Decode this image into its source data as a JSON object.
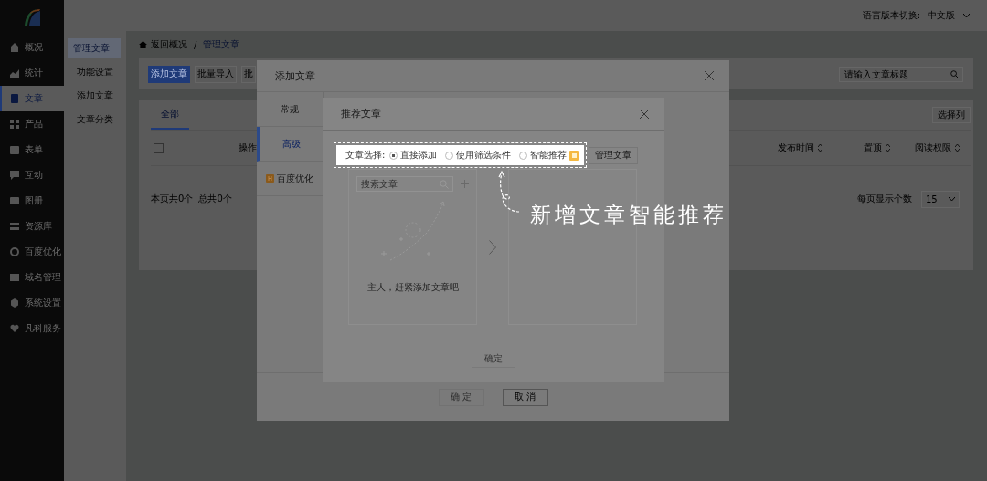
{
  "top_bar": {
    "language_label": "语言版本切换:",
    "language_value": "中文版"
  },
  "sidebar": {
    "items": [
      {
        "label": "概况",
        "selected": false
      },
      {
        "label": "统计",
        "selected": false
      },
      {
        "label": "文章",
        "selected": true
      },
      {
        "label": "产品",
        "selected": false
      },
      {
        "label": "表单",
        "selected": false
      },
      {
        "label": "互动",
        "selected": false
      },
      {
        "label": "图册",
        "selected": false
      },
      {
        "label": "资源库",
        "selected": false
      },
      {
        "label": "百度优化",
        "selected": false
      },
      {
        "label": "域名管理",
        "selected": false
      },
      {
        "label": "系统设置",
        "selected": false
      },
      {
        "label": "凡科服务",
        "selected": false
      }
    ]
  },
  "subnav": {
    "items": [
      {
        "label": "管理文章",
        "selected": true
      },
      {
        "label": "功能设置",
        "selected": false
      },
      {
        "label": "添加文章",
        "selected": false
      },
      {
        "label": "文章分类",
        "selected": false
      }
    ]
  },
  "breadcrumb": {
    "separator": "/",
    "items": [
      "返回概况",
      "管理文章"
    ]
  },
  "toolbar": {
    "buttons": [
      {
        "label": "添加文章",
        "kind": "primary"
      },
      {
        "label": "批量导入",
        "kind": "default"
      },
      {
        "label": "批",
        "kind": "default"
      }
    ],
    "search_placeholder": "请输入文章标题"
  },
  "tabs": [
    {
      "label": "全部",
      "selected": true
    }
  ],
  "column_picker": "选择列",
  "table": {
    "select_all": {
      "checked": false
    },
    "columns": [
      "操作",
      "发布时间",
      "置顶",
      "阅读权限"
    ]
  },
  "pagination": {
    "page_count": "本页共0个",
    "total": "总共0个",
    "per_page_label": "每页显示个数",
    "per_page": "15"
  },
  "add_dialog": {
    "title": "添加文章",
    "tabs": [
      {
        "label": "常规",
        "selected": false,
        "badge": false
      },
      {
        "label": "高级",
        "selected": true,
        "badge": false
      },
      {
        "label": "百度优化",
        "selected": false,
        "badge": true
      }
    ],
    "buttons": [
      {
        "label": "确 定",
        "disabled": true
      },
      {
        "label": "取 消",
        "disabled": false
      }
    ]
  },
  "recommend_dialog": {
    "title": "推荐文章",
    "choice_label": "文章选择:",
    "options": [
      {
        "label": "直接添加",
        "selected": true,
        "badge": false
      },
      {
        "label": "使用筛选条件",
        "selected": false,
        "badge": false
      },
      {
        "label": "智能推荐",
        "selected": false,
        "badge": true
      }
    ],
    "manage_button": "管理文章",
    "search_placeholder": "搜索文章",
    "empty_text": "主人，赶紧添加文章吧",
    "confirm": {
      "label": "确定",
      "disabled": true
    }
  },
  "annotation": "新增文章智能推荐"
}
